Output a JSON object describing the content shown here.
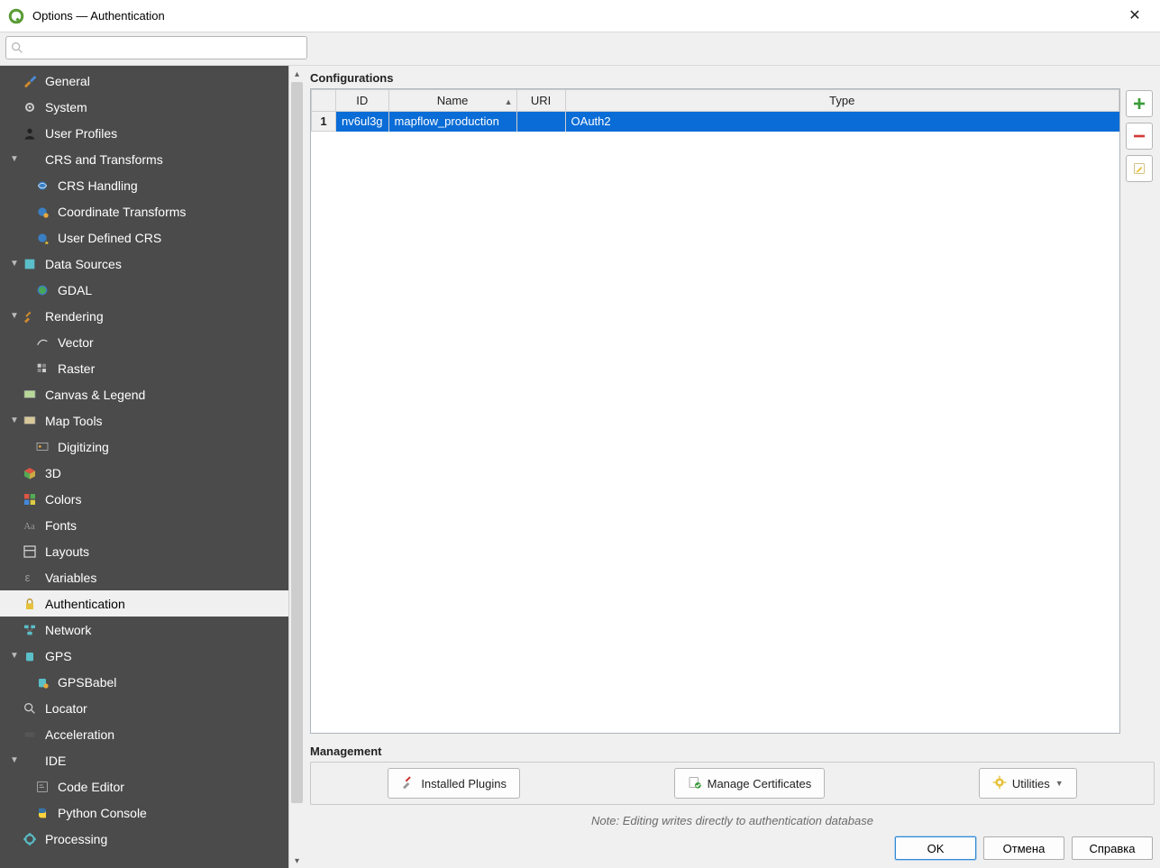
{
  "window": {
    "title": "Options — Authentication"
  },
  "search": {
    "placeholder": ""
  },
  "sidebar": {
    "items": [
      {
        "label": "General"
      },
      {
        "label": "System"
      },
      {
        "label": "User Profiles"
      },
      {
        "label": "CRS and Transforms"
      },
      {
        "label": "CRS Handling"
      },
      {
        "label": "Coordinate Transforms"
      },
      {
        "label": "User Defined CRS"
      },
      {
        "label": "Data Sources"
      },
      {
        "label": "GDAL"
      },
      {
        "label": "Rendering"
      },
      {
        "label": "Vector"
      },
      {
        "label": "Raster"
      },
      {
        "label": "Canvas & Legend"
      },
      {
        "label": "Map Tools"
      },
      {
        "label": "Digitizing"
      },
      {
        "label": "3D"
      },
      {
        "label": "Colors"
      },
      {
        "label": "Fonts"
      },
      {
        "label": "Layouts"
      },
      {
        "label": "Variables"
      },
      {
        "label": "Authentication"
      },
      {
        "label": "Network"
      },
      {
        "label": "GPS"
      },
      {
        "label": "GPSBabel"
      },
      {
        "label": "Locator"
      },
      {
        "label": "Acceleration"
      },
      {
        "label": "IDE"
      },
      {
        "label": "Code Editor"
      },
      {
        "label": "Python Console"
      },
      {
        "label": "Processing"
      }
    ]
  },
  "main": {
    "configurations_label": "Configurations",
    "table": {
      "columns": {
        "id": "ID",
        "name": "Name",
        "uri": "URI",
        "type": "Type"
      },
      "rows": [
        {
          "num": "1",
          "id": "nv6ul3g",
          "name": "mapflow_production",
          "uri": "",
          "type": "OAuth2"
        }
      ]
    },
    "management_label": "Management",
    "buttons": {
      "installed_plugins": "Installed Plugins",
      "manage_certificates": "Manage Certificates",
      "utilities": "Utilities"
    },
    "note": "Note: Editing writes directly to authentication database"
  },
  "footer": {
    "ok": "OK",
    "cancel": "Отмена",
    "help": "Справка"
  }
}
